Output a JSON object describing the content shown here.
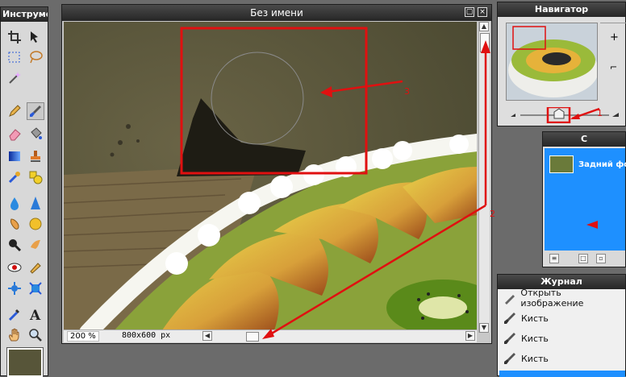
{
  "tools_panel": {
    "title": "Инструмент",
    "color": "#575539"
  },
  "image_window": {
    "title": "Без имени",
    "zoom": "200 %",
    "dimensions": "800x600 px"
  },
  "navigator": {
    "title": "Навигатор"
  },
  "layers": {
    "title": "С",
    "layer_name": "Задний фо"
  },
  "journal": {
    "title": "Журнал",
    "items": [
      "Открыть изображение",
      "Кисть",
      "Кисть",
      "Кисть"
    ]
  },
  "annotations": {
    "a1": "1",
    "a2": "2",
    "a3": "3"
  },
  "colors": {
    "accent": "#1e90ff",
    "annotation": "#e01010",
    "titlebar": "#2b2b2b"
  }
}
